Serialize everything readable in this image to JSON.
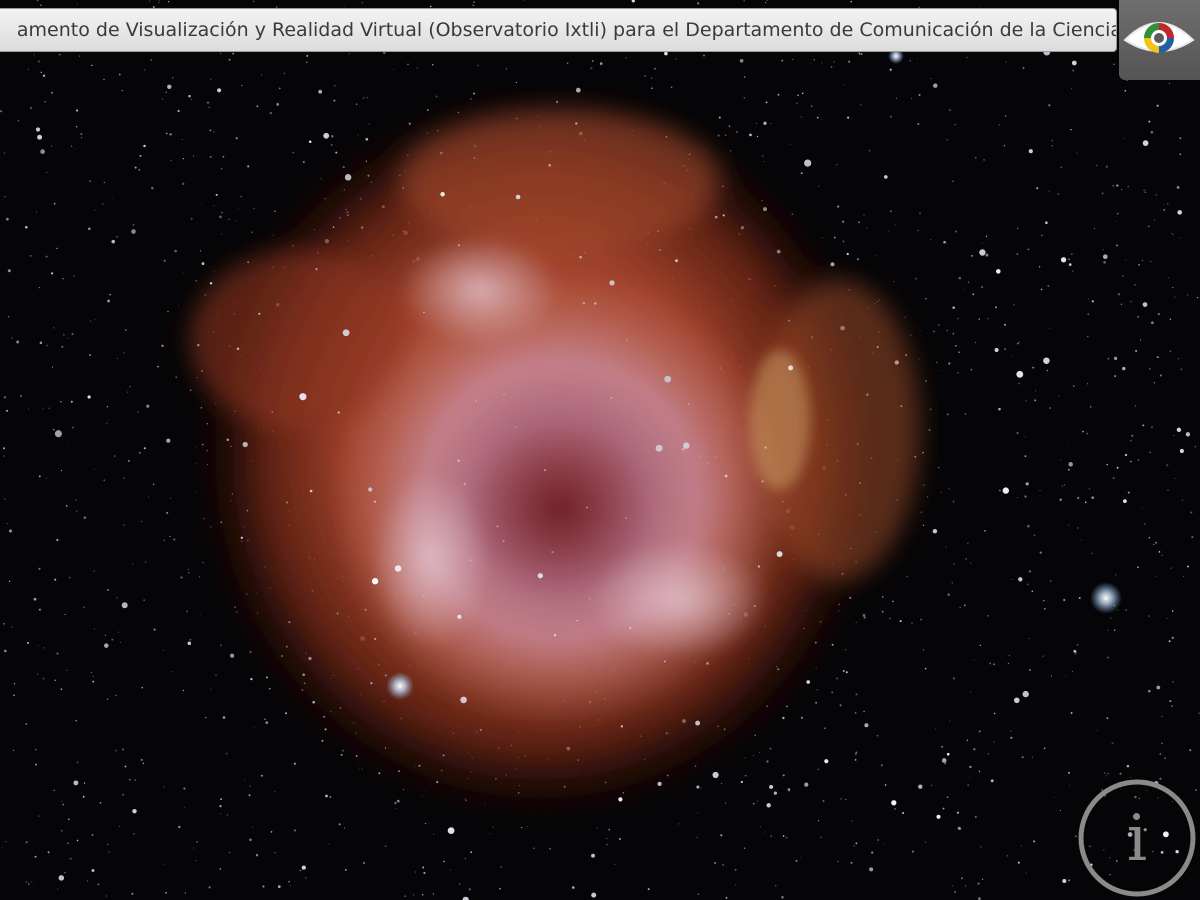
{
  "banner": {
    "text": "amento de Visualización y Realidad Virtual (Observatorio Ixtli) para el Departamento de Comunicación de la Ciencia"
  },
  "logo": {
    "icon": "eye-logo-icon",
    "colors": [
      "#c0282d",
      "#2f8f3a",
      "#1f5fa8",
      "#f2c318"
    ]
  },
  "info_button": {
    "icon": "info-icon",
    "glyph": "i"
  },
  "background_image": {
    "subject": "nebula-photo",
    "colors": {
      "nebula_core": "#b98a9e",
      "nebula_mid": "#a8452d",
      "nebula_edge": "#6d2414",
      "space": "#050406"
    }
  }
}
